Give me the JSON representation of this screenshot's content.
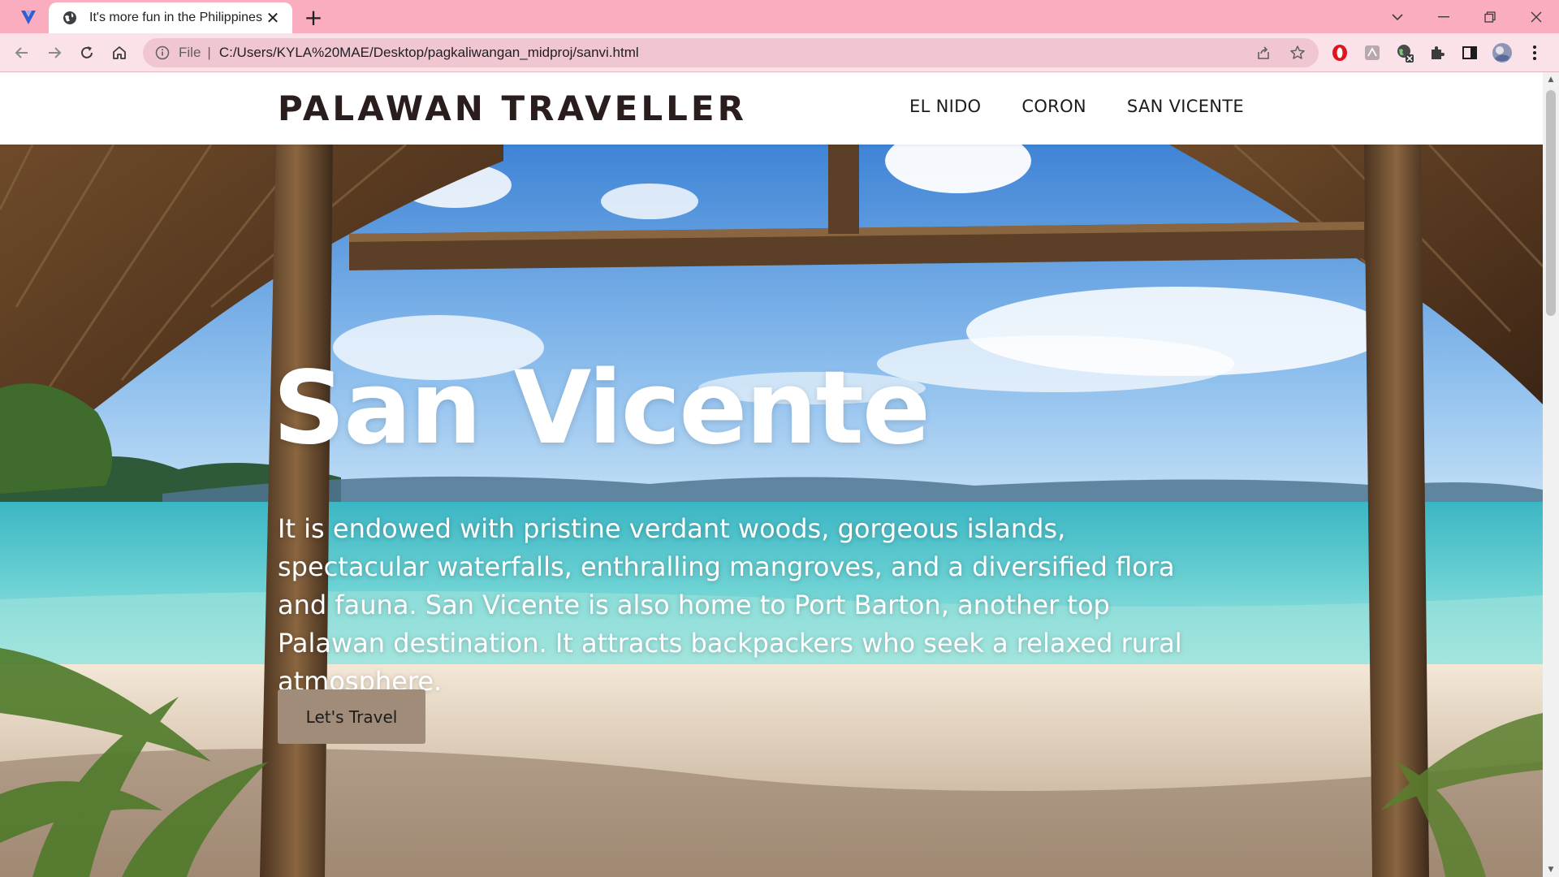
{
  "browser": {
    "tab": {
      "title": "It's more fun in the Philippines"
    },
    "omnibox": {
      "scheme": "File",
      "separator": "|",
      "url": "C:/Users/KYLA%20MAE/Desktop/pagkaliwangan_midproj/sanvi.html"
    },
    "icons": {
      "app": "vivaldi-style-app-icon",
      "tab_favicon": "globe-icon",
      "close": "close-icon",
      "new_tab": "plus-icon",
      "back": "arrow-left-icon",
      "forward": "arrow-right-icon",
      "reload": "reload-icon",
      "home": "home-icon",
      "info": "info-icon",
      "share": "share-icon",
      "bookmark": "star-icon",
      "extensions": [
        "opera-icon",
        "extension-gray-icon",
        "extension-globe-icon",
        "puzzle-icon",
        "sidebar-icon",
        "profile-avatar",
        "more-vert-icon"
      ]
    },
    "colors": {
      "tabbar": "#f9adbf",
      "toolbar": "#fbe2e8",
      "omnibox": "#f0c6d1"
    }
  },
  "site": {
    "brand": "PALAWAN TRAVELLER",
    "nav": [
      {
        "label": "EL NIDO"
      },
      {
        "label": "CORON"
      },
      {
        "label": "SAN VICENTE"
      }
    ]
  },
  "hero": {
    "title": "San Vicente",
    "description": "It is endowed with pristine verdant woods, gorgeous islands, spectacular waterfalls, enthralling mangroves, and a diversified flora and fauna. San Vicente is also home to Port Barton, another top Palawan destination. It attracts backpackers who seek a relaxed rural atmosphere.",
    "cta": "Let's Travel",
    "cta_color": "#a08c79"
  }
}
